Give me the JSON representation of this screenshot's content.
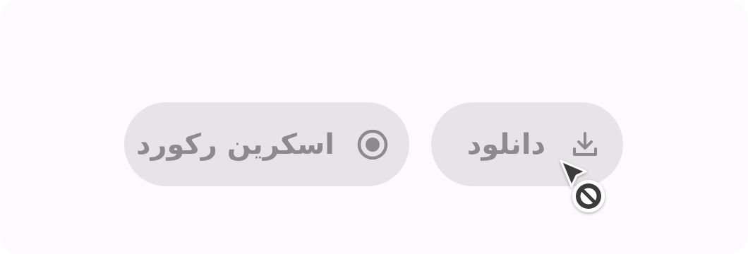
{
  "buttons": {
    "download": {
      "label": "دانلود",
      "icon": "download-icon"
    },
    "screen_record": {
      "label": "اسکرین رکورد",
      "icon": "radio-button-checked-icon"
    }
  },
  "cursor": {
    "icon": "not-allowed-cursor-icon"
  },
  "colors": {
    "background": "#fdfafd",
    "button_fill": "#e7e4e7",
    "button_text": "#8d8a8e",
    "cursor": "#3a3a3a"
  }
}
